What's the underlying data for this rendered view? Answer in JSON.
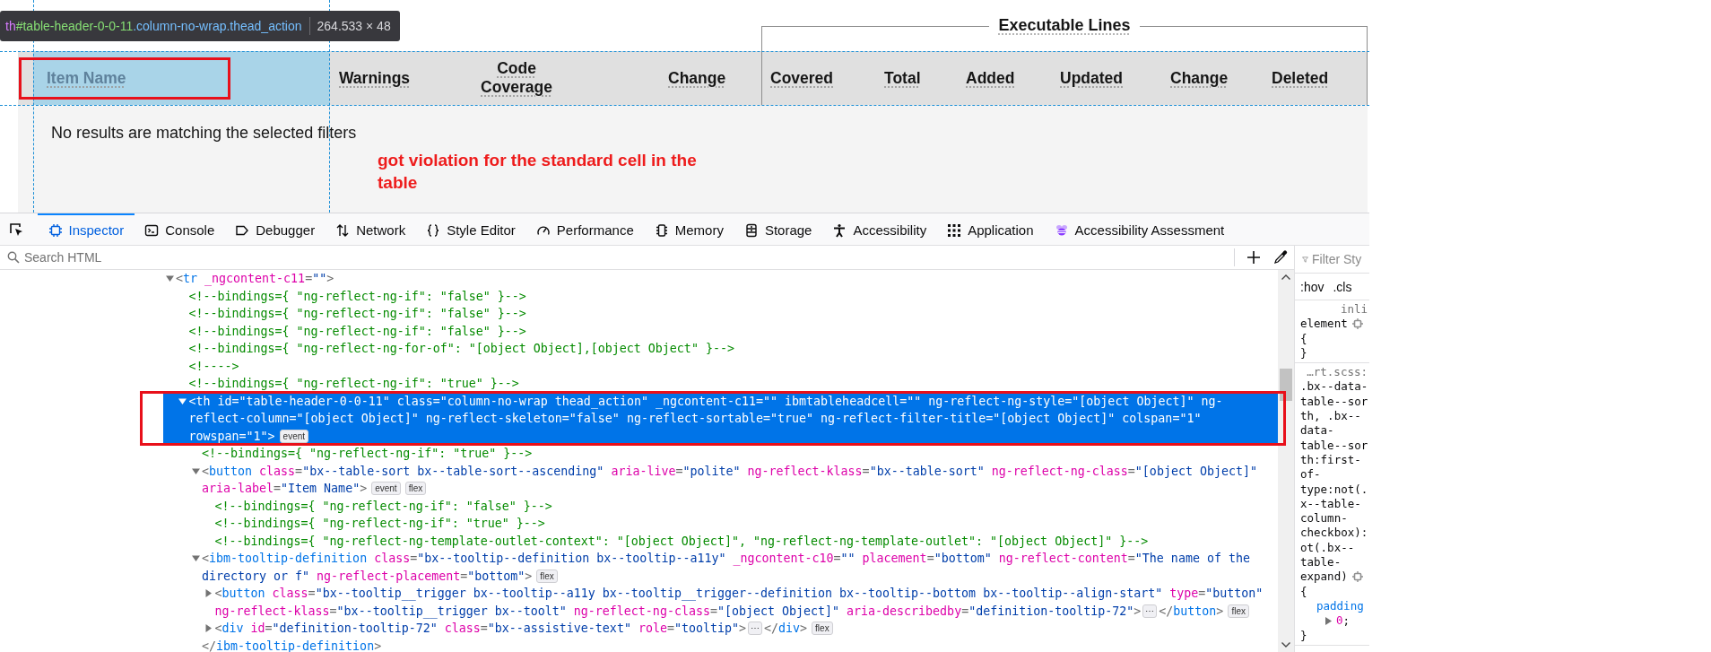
{
  "page": {
    "inspector_tooltip": {
      "tag": "th",
      "id": "#table-header-0-0-11",
      "classes": ".column-no-wrap.thead_action",
      "size": "264.533 × 48"
    },
    "columns": [
      {
        "label": "Item Name",
        "inspected": true
      },
      {
        "label": "Warnings",
        "inspected": false
      },
      {
        "label": "Code Coverage",
        "inspected": false
      },
      {
        "label": "Change",
        "inspected": false
      }
    ],
    "column_group": {
      "title": "Executable Lines",
      "columns": [
        {
          "label": "Covered",
          "inspected": false
        },
        {
          "label": "Total",
          "inspected": false
        },
        {
          "label": "Added",
          "inspected": false
        },
        {
          "label": "Updated",
          "inspected": false
        },
        {
          "label": "Change",
          "inspected": false
        },
        {
          "label": "Deleted",
          "inspected": false
        }
      ]
    },
    "empty_message": "No results are matching the selected filters",
    "annotation": "got violation for the standard cell in the table"
  },
  "devtools": {
    "tabs": [
      {
        "label": "Inspector",
        "selected": true
      },
      {
        "label": "Console",
        "selected": false
      },
      {
        "label": "Debugger",
        "selected": false
      },
      {
        "label": "Network",
        "selected": false
      },
      {
        "label": "Style Editor",
        "selected": false
      },
      {
        "label": "Performance",
        "selected": false
      },
      {
        "label": "Memory",
        "selected": false
      },
      {
        "label": "Storage",
        "selected": false
      },
      {
        "label": "Accessibility",
        "selected": false
      },
      {
        "label": "Application",
        "selected": false
      },
      {
        "label": "Accessibility Assessment",
        "selected": false
      }
    ],
    "search": {
      "placeholder": "Search HTML"
    },
    "html_tree": [
      {
        "kind": "element",
        "expanded": true,
        "selected": false,
        "lines": [
          "<tr _ngcontent-c11=\"\">"
        ],
        "children": [
          {
            "kind": "comment",
            "selected": false,
            "lines": [
              "<!--bindings={ \"ng-reflect-ng-if\": \"false\" }-->"
            ]
          },
          {
            "kind": "comment",
            "selected": false,
            "lines": [
              "<!--bindings={ \"ng-reflect-ng-if\": \"false\" }-->"
            ]
          },
          {
            "kind": "comment",
            "selected": false,
            "lines": [
              "<!--bindings={ \"ng-reflect-ng-if\": \"false\" }-->"
            ]
          },
          {
            "kind": "comment",
            "selected": false,
            "lines": [
              "<!--bindings={ \"ng-reflect-ng-for-of\": \"[object Object],[object Object\" }-->"
            ]
          },
          {
            "kind": "comment",
            "selected": false,
            "lines": [
              "<!---->"
            ]
          },
          {
            "kind": "comment",
            "selected": false,
            "lines": [
              "<!--bindings={ \"ng-reflect-ng-if\": \"true\" }-->"
            ]
          },
          {
            "kind": "element",
            "expanded": true,
            "selected": true,
            "lines": [
              "<th id=\"table-header-0-0-11\" class=\"column-no-wrap thead_action\" _ngcontent-c11=\"\" ibmtableheadcell=\"\" ng-reflect-ng-style=\"[object Object]\" ng-",
              "reflect-column=\"[object Object]\" ng-reflect-skeleton=\"false\" ng-reflect-sortable=\"true\" ng-reflect-filter-title=\"[object Object]\" colspan=\"1\"",
              "rowspan=\"1\">"
            ],
            "badges": [
              "event"
            ],
            "children": [
              {
                "kind": "comment",
                "selected": false,
                "lines": [
                  "<!--bindings={ \"ng-reflect-ng-if\": \"true\" }-->"
                ]
              },
              {
                "kind": "element",
                "expanded": true,
                "selected": false,
                "lines": [
                  "<button class=\"bx--table-sort bx--table-sort--ascending\" aria-live=\"polite\" ng-reflect-klass=\"bx--table-sort\" ng-reflect-ng-class=\"[object Object]\"",
                  "aria-label=\"Item Name\">"
                ],
                "badges": [
                  "event",
                  "flex"
                ],
                "children": [
                  {
                    "kind": "comment",
                    "selected": false,
                    "lines": [
                      "<!--bindings={ \"ng-reflect-ng-if\": \"false\" }-->"
                    ]
                  },
                  {
                    "kind": "comment",
                    "selected": false,
                    "lines": [
                      "<!--bindings={ \"ng-reflect-ng-if\": \"true\" }-->"
                    ]
                  },
                  {
                    "kind": "comment",
                    "selected": false,
                    "lines": [
                      "<!--bindings={ \"ng-reflect-ng-template-outlet-context\": \"[object Object]\", \"ng-reflect-ng-template-outlet\": \"[object Object]\" }-->"
                    ]
                  }
                ]
              },
              {
                "kind": "element",
                "expanded": true,
                "selected": false,
                "lines": [
                  "<ibm-tooltip-definition class=\"bx--tooltip--definition bx--tooltip--a11y\" _ngcontent-c10=\"\" placement=\"bottom\" ng-reflect-content=\"The name of the",
                  "directory or f\" ng-reflect-placement=\"bottom\">"
                ],
                "badges": [
                  "flex"
                ],
                "end_tag": "</ibm-tooltip-definition>",
                "children": [
                  {
                    "kind": "element",
                    "expanded": false,
                    "selected": false,
                    "lines": [
                      "<button class=\"bx--tooltip__trigger bx--tooltip--a11y bx--tooltip__trigger--definition bx--tooltip--bottom bx--tooltip--align-start\" type=\"button\"",
                      "ng-reflect-klass=\"bx--tooltip__trigger bx--toolt\" ng-reflect-ng-class=\"[object Object]\" aria-describedby=\"definition-tooltip-72\">"
                    ],
                    "collapsed_content": "⋯",
                    "closing_tag": "</button>",
                    "badges": [
                      "flex"
                    ]
                  },
                  {
                    "kind": "element",
                    "expanded": false,
                    "selected": false,
                    "lines": [
                      "<div id=\"definition-tooltip-72\" class=\"bx--assistive-text\" role=\"tooltip\">"
                    ],
                    "collapsed_content": "⋯",
                    "closing_tag": "</div>",
                    "badges": [
                      "flex"
                    ]
                  }
                ]
              }
            ]
          }
        ]
      }
    ],
    "rules_panel": {
      "filter": {
        "placeholder": "Filter Sty"
      },
      "toggles": [
        ":hov",
        ".cls"
      ],
      "rules": [
        {
          "source": "inli",
          "selector_lines": [
            "element"
          ],
          "open": "{",
          "close": "}"
        },
        {
          "source": "…rt.scss:",
          "selector_lines": [
            ".bx--data-",
            "table--sor",
            "th, .bx--",
            "data-",
            "table--sor",
            "th:first-",
            "of-",
            "type:not(.",
            "x--table-",
            "column-",
            "checkbox):",
            "ot(.bx--",
            "table-",
            "expand)"
          ],
          "open": "{",
          "declarations": [
            {
              "property": "padding",
              "value": "0",
              "terminator": ";"
            }
          ],
          "close": "}"
        }
      ]
    }
  }
}
